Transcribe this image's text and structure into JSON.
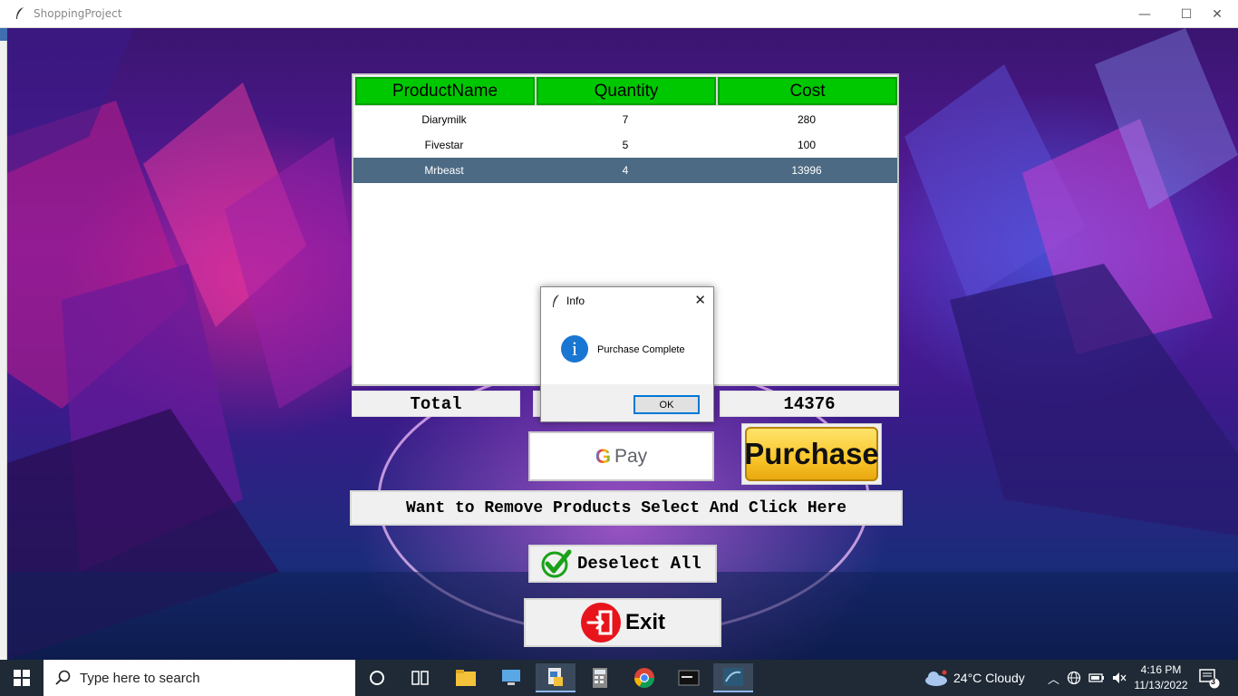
{
  "window": {
    "title": "ShoppingProject",
    "minimize_glyph": "—",
    "maximize_glyph": "☐",
    "close_glyph": "✕"
  },
  "table": {
    "headers": [
      "ProductName",
      "Quantity",
      "Cost"
    ],
    "rows": [
      {
        "name": "Diarymilk",
        "quantity": "7",
        "cost": "280",
        "selected": false
      },
      {
        "name": "Fivestar",
        "quantity": "5",
        "cost": "100",
        "selected": false
      },
      {
        "name": "Mrbeast",
        "quantity": "4",
        "cost": "13996",
        "selected": true
      }
    ]
  },
  "summary": {
    "total_label": "Total",
    "middle_value": "",
    "total_value": "14376"
  },
  "buttons": {
    "gpay_g": "G",
    "gpay_label": "Pay",
    "purchase_label": "Purchase",
    "remove_label": "Want to Remove Products Select And Click Here",
    "deselect_label": "Deselect All",
    "exit_label": "Exit"
  },
  "dialog": {
    "title": "Info",
    "message": "Purchase Complete",
    "ok_label": "OK",
    "icon_glyph": "i",
    "close_glyph": "✕"
  },
  "taskbar": {
    "search_placeholder": "Type here to search",
    "weather": "24°C  Cloudy",
    "time": "4:16 PM",
    "date": "11/13/2022",
    "notification_count": "3"
  },
  "colors": {
    "header_green": "#00c800",
    "selected_row": "#4c6a84",
    "purchase_yellow": "#f9c62a",
    "dialog_accent": "#0078d7",
    "taskbar": "#1f2a36"
  }
}
